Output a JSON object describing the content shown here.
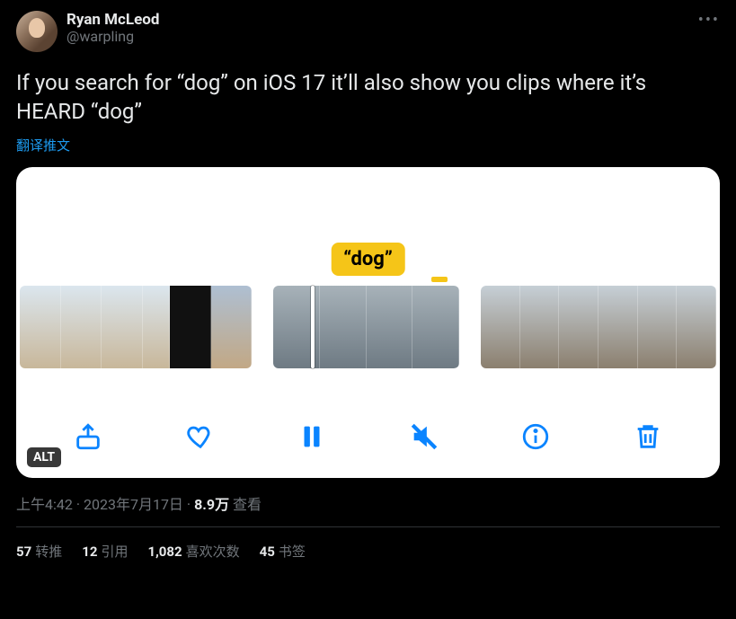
{
  "author": {
    "display_name": "Ryan McLeod",
    "handle": "@warpling"
  },
  "body": "If you search for “dog” on iOS 17 it’ll also show you clips where it’s HEARD “dog”",
  "translate_label": "翻译推文",
  "media": {
    "highlight_tag": "“dog”",
    "alt_button": "ALT",
    "toolbar": {
      "share": "share",
      "like": "like",
      "pause": "pause",
      "mute": "mute",
      "info": "info",
      "trash": "trash"
    }
  },
  "meta": {
    "time": "上午4:42",
    "sep1": " · ",
    "date": "2023年7月17日",
    "sep2": " · ",
    "views_count": "8.9万",
    "views_label": " 查看"
  },
  "stats": {
    "retweets_count": "57",
    "retweets_label": "转推",
    "quotes_count": "12",
    "quotes_label": "引用",
    "likes_count": "1,082",
    "likes_label": "喜欢次数",
    "bookmarks_count": "45",
    "bookmarks_label": "书签"
  }
}
